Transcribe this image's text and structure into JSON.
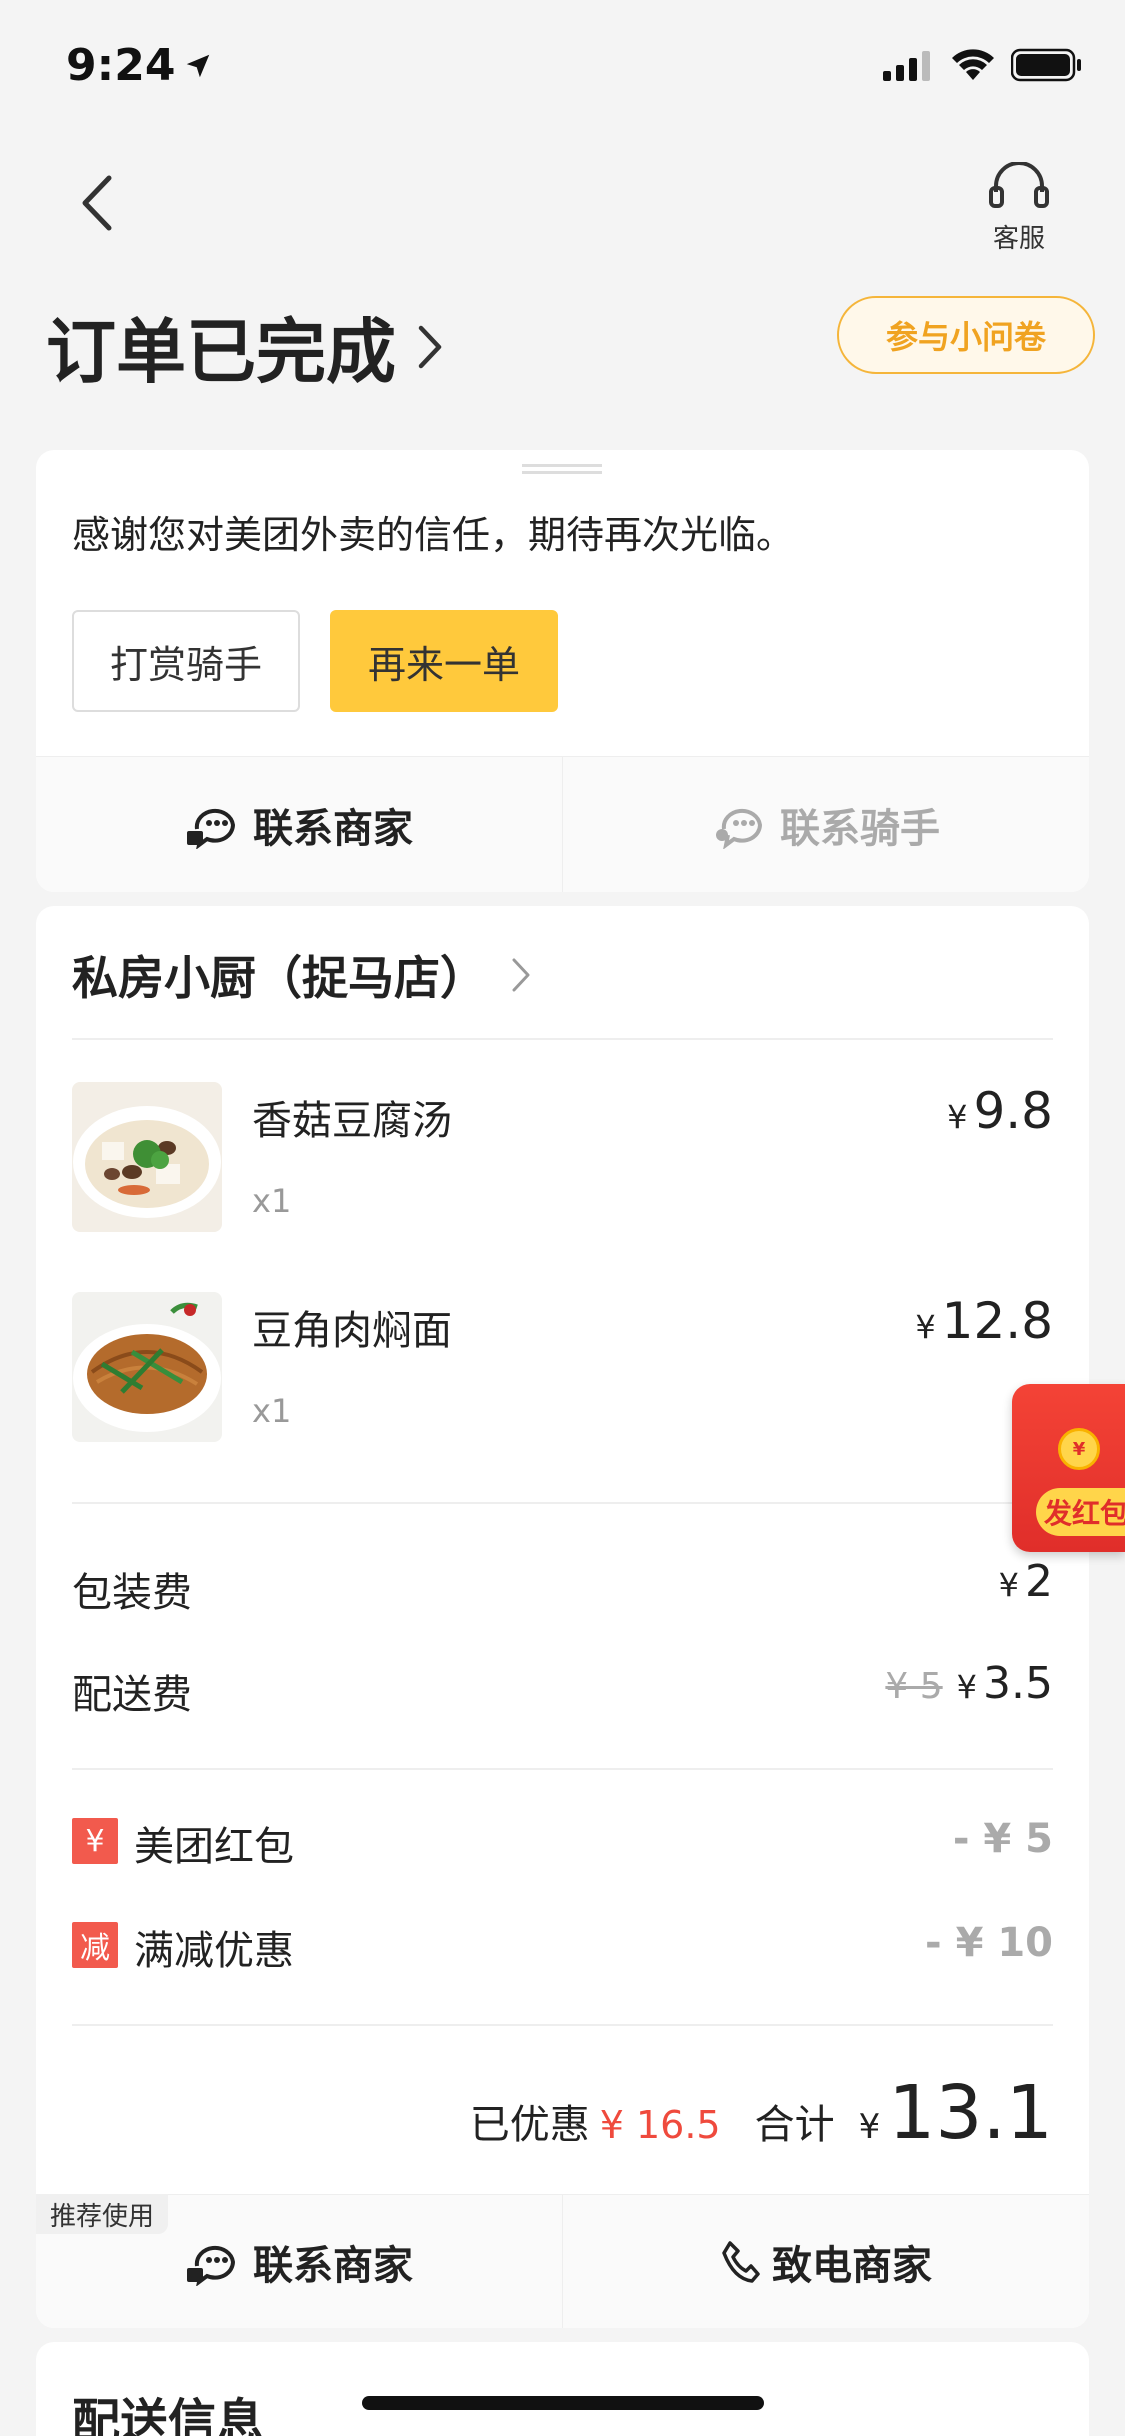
{
  "status_bar": {
    "time": "9:24"
  },
  "header": {
    "service_label": "客服",
    "order_status": "订单已完成",
    "survey_button": "参与小问卷"
  },
  "thanks_card": {
    "message": "感谢您对美团外卖的信任，期待再次光临。",
    "tip_rider_button": "打赏骑手",
    "reorder_button": "再来一单",
    "contact_merchant": "联系商家",
    "contact_rider": "联系骑手"
  },
  "order": {
    "shop_name": "私房小厨（捉马店）",
    "currency": "¥",
    "items": [
      {
        "name": "香菇豆腐汤",
        "qty": "x1",
        "price": "9.8"
      },
      {
        "name": "豆角肉焖面",
        "qty": "x1",
        "price": "12.8"
      }
    ],
    "fees": [
      {
        "label": "包装费",
        "old_value": "",
        "value": "2"
      },
      {
        "label": "配送费",
        "old_value": "¥ 5",
        "value": "3.5"
      }
    ],
    "discounts": [
      {
        "tag": "¥",
        "label": "美团红包",
        "value": "- ¥ 5"
      },
      {
        "tag": "减",
        "label": "满减优惠",
        "value": "- ¥ 10"
      }
    ],
    "saved_label": "已优惠",
    "saved_value": "¥ 16.5",
    "total_label": "合计",
    "total_value": "13.1",
    "recommend_tag": "推荐使用",
    "contact_merchant": "联系商家",
    "call_merchant": "致电商家"
  },
  "red_packet": {
    "label": "发红包",
    "coin_symbol": "¥"
  },
  "delivery": {
    "title": "配送信息"
  },
  "colors": {
    "accent_yellow": "#ffc93c",
    "survey_orange": "#f0a321",
    "discount_red": "#ef4a3d"
  }
}
